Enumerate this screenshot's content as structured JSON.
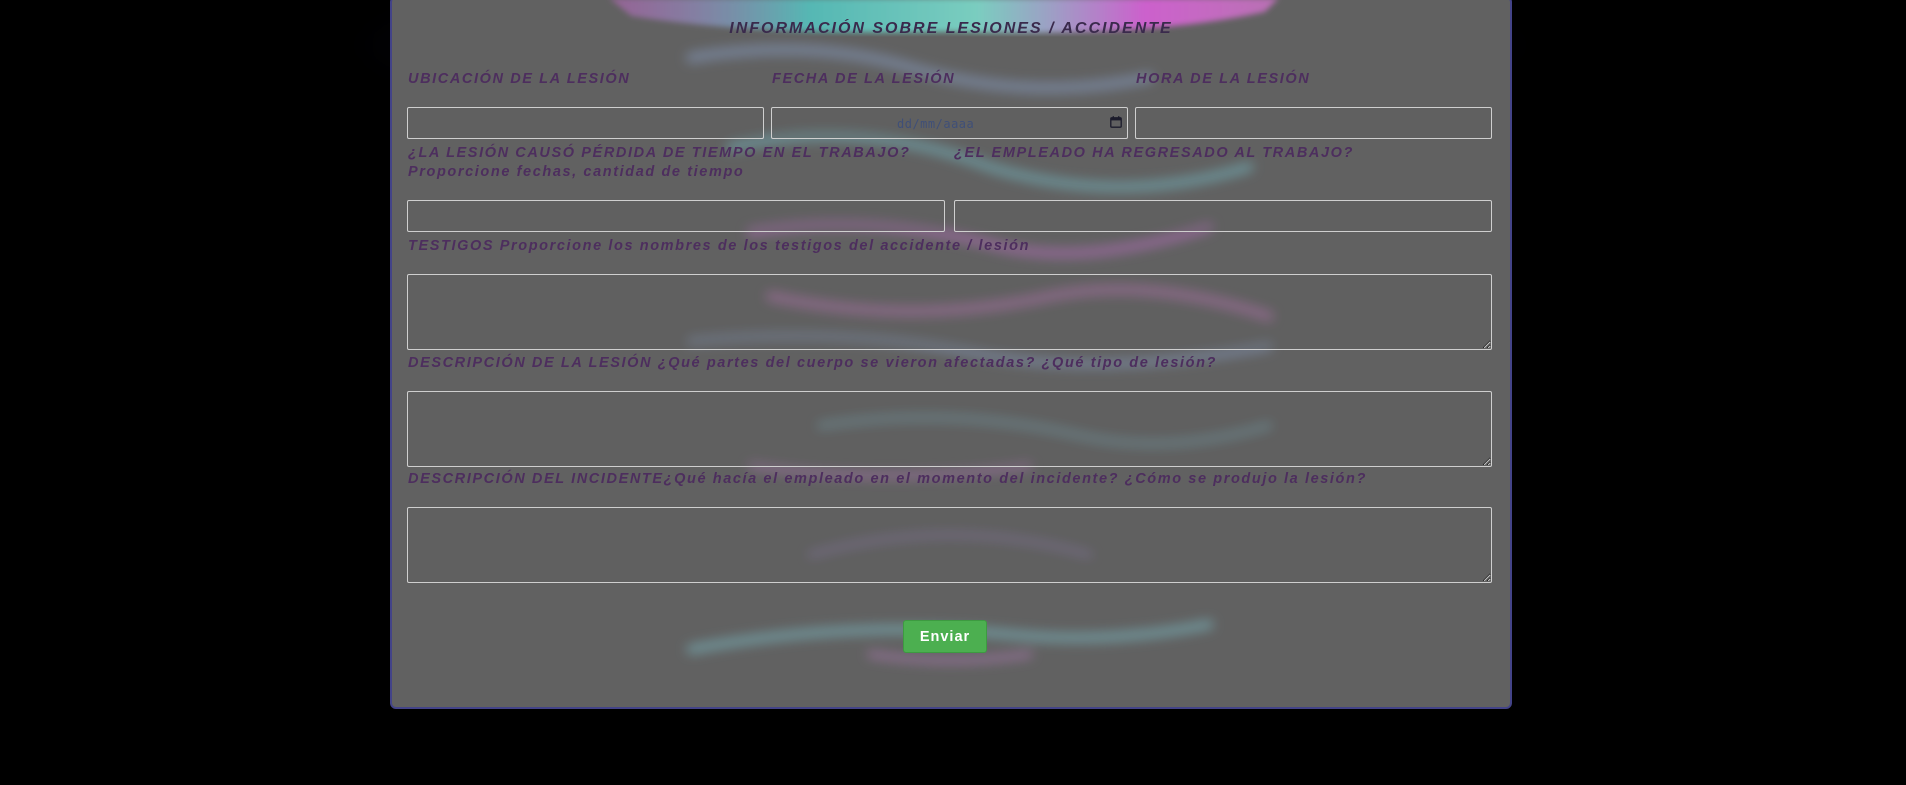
{
  "form": {
    "title": "INFORMACIÓN SOBRE LESIONES / ACCIDENTE",
    "fields": {
      "location": {
        "label": "UBICACIÓN DE LA LESIÓN",
        "value": ""
      },
      "date": {
        "label": "FECHA DE LA LESIÓN",
        "placeholder": "dd/mm/aaaa",
        "value": ""
      },
      "time": {
        "label": "HORA DE LA LESIÓN",
        "value": ""
      },
      "time_lost": {
        "label": "¿LA LESIÓN CAUSÓ PÉRDIDA DE TIEMPO EN EL TRABAJO?",
        "sublabel": "Proporcione fechas, cantidad de tiempo",
        "value": ""
      },
      "returned": {
        "label": "¿EL EMPLEADO HA REGRESADO AL TRABAJO?",
        "value": ""
      },
      "witnesses": {
        "label": "TESTIGOS Proporcione los nombres de los testigos del accidente / lesión",
        "value": ""
      },
      "injury_description": {
        "label": "DESCRIPCIÓN DE LA LESIÓN ¿Qué partes del cuerpo se vieron afectadas? ¿Qué tipo de lesión?",
        "value": ""
      },
      "incident_description": {
        "label": "DESCRIPCIÓN DEL INCIDENTE¿Qué hacía el empleado en el momento del incidente? ¿Cómo se produjo la lesión?",
        "value": ""
      }
    },
    "submit_label": "Enviar"
  },
  "colors": {
    "page_background": "#000000",
    "panel_background": "#616161",
    "panel_border": "#434388",
    "label_text": "#4d2e5e",
    "submit_button": "#4caf50"
  },
  "icons": {
    "date_picker": "calendar-icon"
  }
}
